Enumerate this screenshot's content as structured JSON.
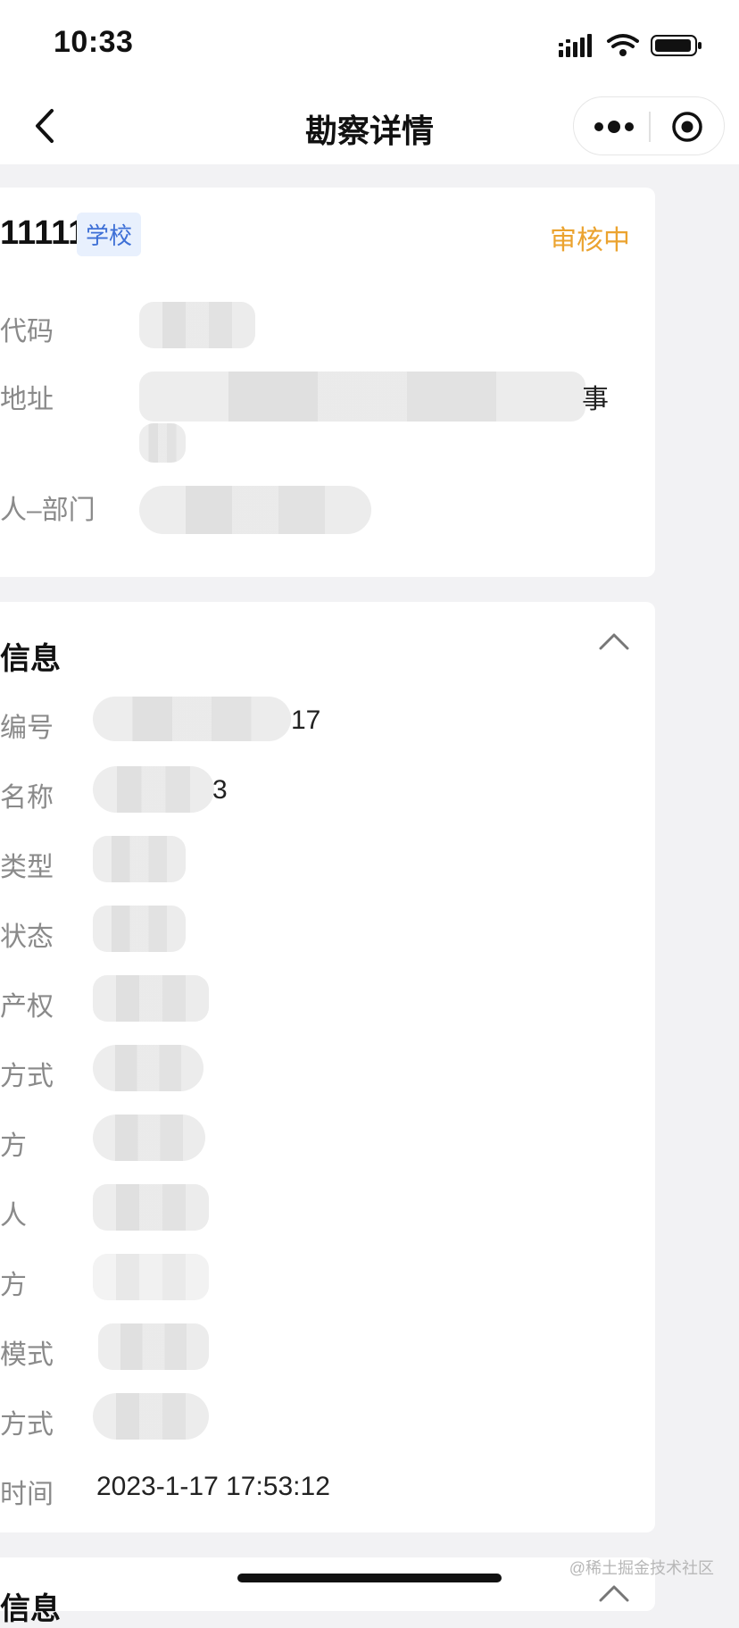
{
  "status_bar": {
    "time": "10:33"
  },
  "nav": {
    "title": "勘察详情"
  },
  "card_basic": {
    "name": "11111",
    "tag": "学校",
    "status": "审核中",
    "rows": [
      {
        "label": "代码",
        "value": ""
      },
      {
        "label": "地址",
        "value": "事"
      },
      {
        "label": "人–部门",
        "value": ""
      }
    ]
  },
  "card_info": {
    "title": "信息",
    "rows": [
      {
        "label": "编号",
        "value": "17"
      },
      {
        "label": "名称",
        "value": "3"
      },
      {
        "label": "类型",
        "value": ""
      },
      {
        "label": "状态",
        "value": ""
      },
      {
        "label": "产权",
        "value": ""
      },
      {
        "label": "方式",
        "value": ""
      },
      {
        "label": "方",
        "value": ""
      },
      {
        "label": "人",
        "value": ""
      },
      {
        "label": "方",
        "value": ""
      },
      {
        "label": "模式",
        "value": ""
      },
      {
        "label": "方式",
        "value": ""
      },
      {
        "label": "时间",
        "value": "2023-1-17 17:53:12"
      }
    ]
  },
  "card_next": {
    "title": "信息"
  },
  "watermark": "@稀土掘金技术社区"
}
